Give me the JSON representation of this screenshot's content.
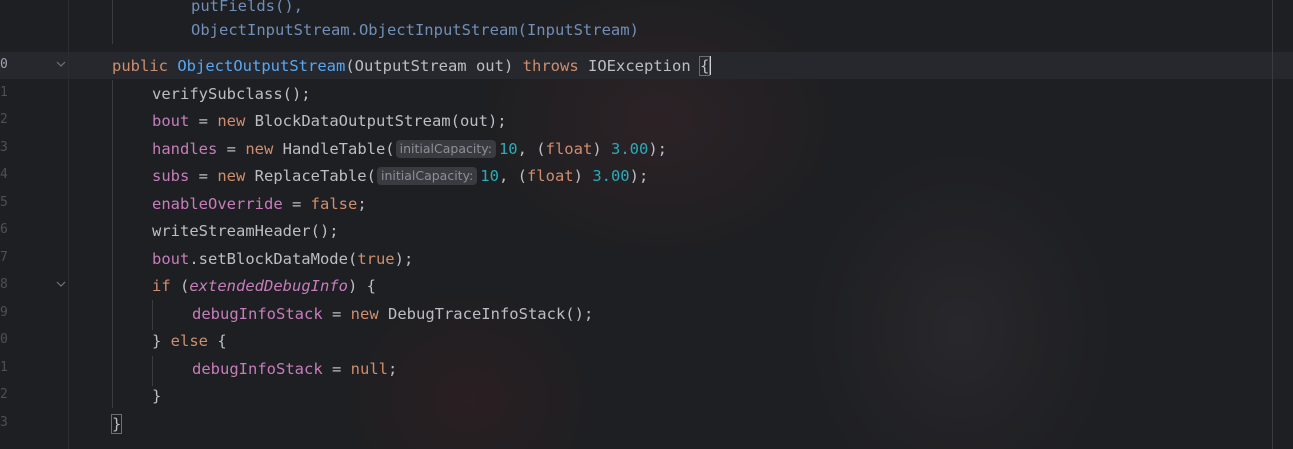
{
  "editor": {
    "language": "Java",
    "colors": {
      "background": "#1e1f22",
      "keyword": "#cf8e6d",
      "method_declaration": "#56a8f5",
      "field": "#c77dbb",
      "number": "#2aacb8",
      "identifier": "#bcbec4",
      "inlay_hint_bg": "#393b40"
    },
    "line_numbers": [
      "0",
      "1",
      "2",
      "3",
      "4",
      "5",
      "6",
      "7",
      "8",
      "9",
      "0",
      "1",
      "2",
      "3"
    ],
    "usage_hint": {
      "line1": "putFields(),",
      "line2": "ObjectInputStream.ObjectInputStream(InputStream)"
    },
    "code": {
      "l0": {
        "kw_public": "public",
        "method_name": "ObjectOutputStream",
        "params": "(OutputStream out)",
        "kw_throws": "throws",
        "exception": "IOException",
        "brace": "{"
      },
      "l1": {
        "text": "verifySubclass();"
      },
      "l2": {
        "field": "bout",
        "op": " = ",
        "kw_new": "new",
        "rest": " BlockDataOutputStream(out);"
      },
      "l3": {
        "field": "handles",
        "op": " = ",
        "kw_new": "new",
        "ctor": " HandleTable(",
        "hint": "initialCapacity:",
        "num1": "10",
        "mid": ", (",
        "kw_float": "float",
        "mid2": ") ",
        "num2": "3.00",
        "end": ");"
      },
      "l4": {
        "field": "subs",
        "op": " = ",
        "kw_new": "new",
        "ctor": " ReplaceTable(",
        "hint": "initialCapacity:",
        "num1": "10",
        "mid": ", (",
        "kw_float": "float",
        "mid2": ") ",
        "num2": "3.00",
        "end": ");"
      },
      "l5": {
        "field": "enableOverride",
        "op": " = ",
        "kw_false": "false",
        "end": ";"
      },
      "l6": {
        "text": "writeStreamHeader();"
      },
      "l7": {
        "field": "bout",
        "call": ".setBlockDataMode(",
        "kw_true": "true",
        "end": ");"
      },
      "l8": {
        "kw_if": "if",
        "open": " (",
        "field_italic": "extendedDebugInfo",
        "close": ") {"
      },
      "l9": {
        "field": "debugInfoStack",
        "op": " = ",
        "kw_new": "new",
        "rest": " DebugTraceInfoStack();"
      },
      "l10": {
        "close": "} ",
        "kw_else": "else",
        "open": " {"
      },
      "l11": {
        "field": "debugInfoStack",
        "op": " = ",
        "kw_null": "null",
        "end": ";"
      },
      "l12": {
        "text": "}"
      },
      "l13": {
        "text": "}"
      }
    }
  }
}
